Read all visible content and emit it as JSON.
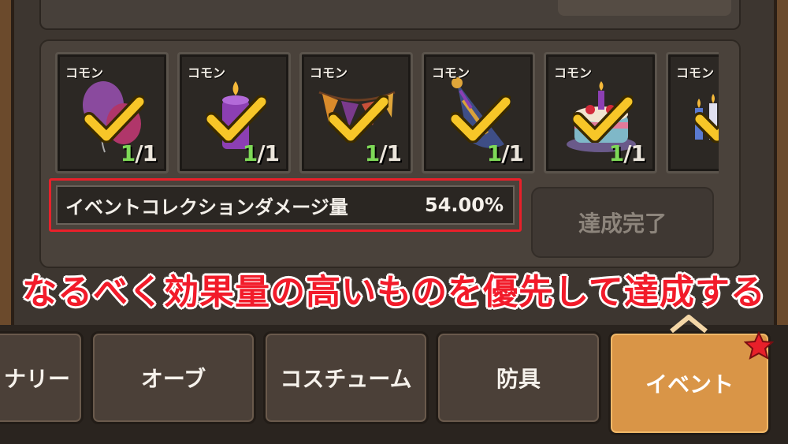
{
  "items": [
    {
      "rarity": "コモン",
      "art": "balloons",
      "current": "1",
      "max": "/1"
    },
    {
      "rarity": "コモン",
      "art": "candle",
      "current": "1",
      "max": "/1"
    },
    {
      "rarity": "コモン",
      "art": "bunting-flags",
      "current": "1",
      "max": "/1"
    },
    {
      "rarity": "コモン",
      "art": "party-hat",
      "current": "1",
      "max": "/1"
    },
    {
      "rarity": "コモン",
      "art": "birthday-cake",
      "current": "1",
      "max": "/1"
    },
    {
      "rarity": "コモン",
      "art": "candles",
      "current": "",
      "max": ""
    }
  ],
  "stat": {
    "label": "イベントコレクションダメージ量",
    "value": "54.00%"
  },
  "complete_button": "達成完了",
  "caption": "なるべく効果量の高いものを優先して達成する",
  "tabs": [
    "ナリー",
    "オーブ",
    "コスチューム",
    "防具",
    "イベント"
  ],
  "colors": {
    "accent_red": "#f21b2a",
    "count_green": "#7ed957",
    "active_tab": "#d99547"
  }
}
